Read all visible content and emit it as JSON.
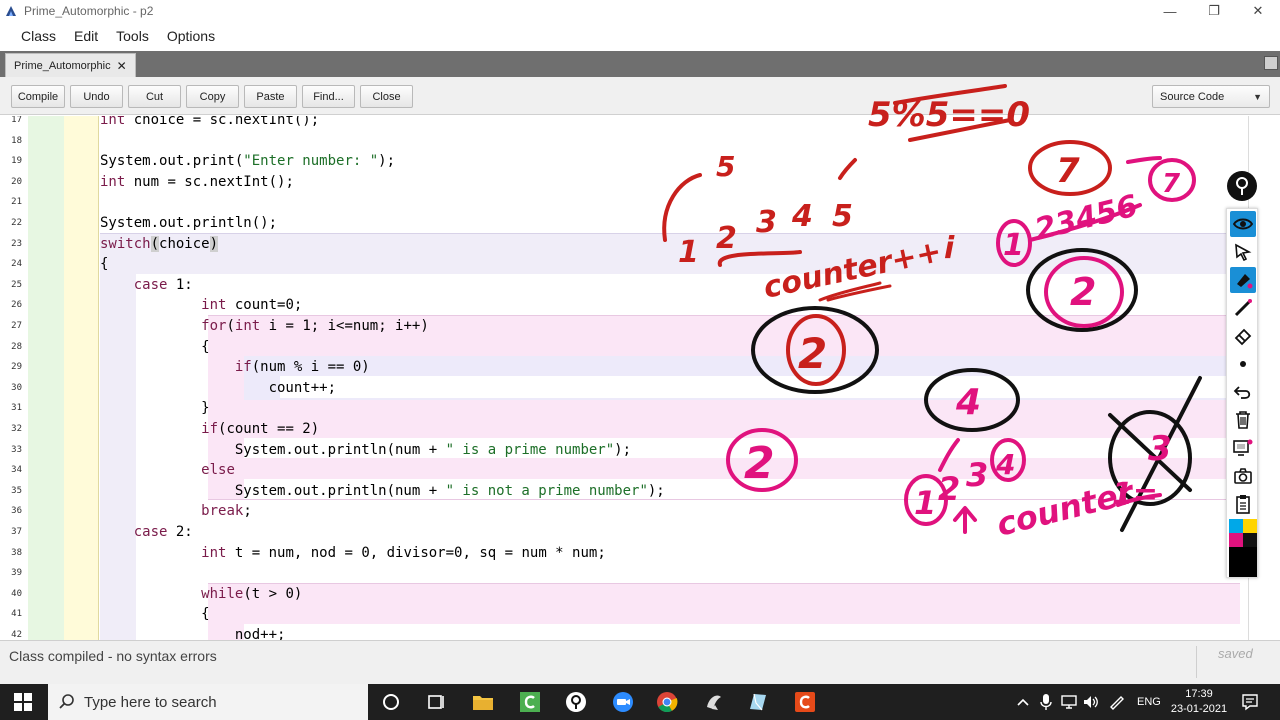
{
  "window": {
    "title": "Prime_Automorphic - p2",
    "minimize": "—",
    "restore": "❐",
    "close": "✕"
  },
  "menu": [
    "Class",
    "Edit",
    "Tools",
    "Options"
  ],
  "tab": {
    "label": "Prime_Automorphic",
    "close": "✕"
  },
  "toolbar": {
    "buttons": [
      "Compile",
      "Undo",
      "Cut",
      "Copy",
      "Paste",
      "Find...",
      "Close"
    ],
    "view_select": "Source Code"
  },
  "editor": {
    "line_numbers": [
      "17",
      "18",
      "19",
      "20",
      "21",
      "22",
      "23",
      "24",
      "25",
      "26",
      "27",
      "28",
      "29",
      "30",
      "31",
      "32",
      "33",
      "34",
      "35",
      "36",
      "37",
      "38",
      "39",
      "40",
      "41",
      "42"
    ],
    "lines": [
      [
        {
          "t": "int",
          "c": "kw"
        },
        {
          "t": " choice = sc.nextInt();"
        }
      ],
      [],
      [
        {
          "t": "System.out.print("
        },
        {
          "t": "\"Enter number: \"",
          "c": "str"
        },
        {
          "t": ");"
        }
      ],
      [
        {
          "t": "int",
          "c": "kw"
        },
        {
          "t": " num = sc.nextInt();"
        }
      ],
      [],
      [
        {
          "t": "System.out.println();"
        }
      ],
      [
        {
          "t": "switch",
          "c": "kw"
        },
        {
          "t": "(",
          "c": "brk"
        },
        {
          "t": "choice"
        },
        {
          "t": ")",
          "c": "brk"
        }
      ],
      [
        {
          "t": "{"
        }
      ],
      [
        {
          "t": "    "
        },
        {
          "t": "case",
          "c": "kw"
        },
        {
          "t": " 1:"
        }
      ],
      [
        {
          "t": "            "
        },
        {
          "t": "int",
          "c": "kw"
        },
        {
          "t": " count=0;"
        }
      ],
      [
        {
          "t": "            "
        },
        {
          "t": "for",
          "c": "kw"
        },
        {
          "t": "("
        },
        {
          "t": "int",
          "c": "kw"
        },
        {
          "t": " i = 1; i<=num; i++)"
        }
      ],
      [
        {
          "t": "            {"
        }
      ],
      [
        {
          "t": "                "
        },
        {
          "t": "if",
          "c": "kw"
        },
        {
          "t": "(num % i == 0)"
        }
      ],
      [
        {
          "t": "                    count++;"
        }
      ],
      [
        {
          "t": "            }"
        }
      ],
      [
        {
          "t": "            "
        },
        {
          "t": "if",
          "c": "kw"
        },
        {
          "t": "(count == 2)"
        }
      ],
      [
        {
          "t": "                System.out.println(num + "
        },
        {
          "t": "\" is a prime number\"",
          "c": "str"
        },
        {
          "t": ");"
        }
      ],
      [
        {
          "t": "            "
        },
        {
          "t": "else",
          "c": "kw"
        }
      ],
      [
        {
          "t": "                System.out.println(num + "
        },
        {
          "t": "\" is not a prime number\"",
          "c": "str"
        },
        {
          "t": ");"
        }
      ],
      [
        {
          "t": "            "
        },
        {
          "t": "break",
          "c": "kw"
        },
        {
          "t": ";"
        }
      ],
      [
        {
          "t": "    "
        },
        {
          "t": "case",
          "c": "kw"
        },
        {
          "t": " 2:"
        }
      ],
      [
        {
          "t": "            "
        },
        {
          "t": "int",
          "c": "kw"
        },
        {
          "t": " t = num, nod = 0, divisor=0, sq = num * num;"
        }
      ],
      [],
      [
        {
          "t": "            "
        },
        {
          "t": "while",
          "c": "kw"
        },
        {
          "t": "(t > 0)"
        }
      ],
      [
        {
          "t": "            {"
        }
      ],
      [
        {
          "t": "                nod++;"
        }
      ]
    ]
  },
  "annotations": {
    "text": [
      "5%5==0",
      "5",
      "1",
      "2",
      "3",
      "4",
      "5",
      "counter++",
      "i",
      "7",
      "7",
      "1",
      "23456",
      "2",
      "2",
      "4",
      "2",
      "1",
      "2",
      "3",
      "4",
      "counter",
      "1=",
      "3"
    ],
    "colors": {
      "red": "#c8201c",
      "magenta": "#e0127e",
      "black": "#111111"
    }
  },
  "annotation_tools": [
    "pin-icon",
    "eye-icon",
    "cursor-icon",
    "highlighter-icon",
    "pen-icon",
    "eraser-icon",
    "dot-icon",
    "undo-icon",
    "trash-icon",
    "screen-icon",
    "camera-icon",
    "clipboard-icon",
    "color-palette"
  ],
  "status": {
    "message": "Class compiled - no syntax errors",
    "saved": "saved"
  },
  "taskbar": {
    "search_placeholder": "Type here to search",
    "language": "ENG",
    "time": "17:39",
    "date": "23-01-2021"
  }
}
